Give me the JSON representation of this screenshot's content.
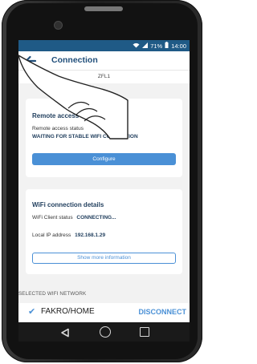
{
  "status_bar": {
    "battery": "71%",
    "time": "14:00",
    "icons": [
      "wifi-icon",
      "signal-icon",
      "battery-icon"
    ]
  },
  "appbar": {
    "title": "Connection",
    "back_icon": "arrow-left-icon"
  },
  "device": {
    "name": "ZFL1"
  },
  "remote_access": {
    "title": "Remote access details",
    "status_label": "Remote access status",
    "status_value": "WAITING FOR STABLE WIFI CONNECTION",
    "configure_button": "Configure"
  },
  "wifi": {
    "title": "WiFi connection details",
    "client_status_label": "WiFi Client status",
    "client_status_value": "CONNECTING...",
    "ip_label": "Local IP address",
    "ip_value": "192.168.1.29",
    "more_button": "Show more information"
  },
  "selected_network": {
    "section_label": "SELECTED WIFI NETWORK",
    "name": "FAKRO/HOME",
    "disconnect_button": "DISCONNECT"
  },
  "colors": {
    "accent": "#4a90d6",
    "status_bar": "#1f5a86",
    "title": "#1f4e7a"
  }
}
